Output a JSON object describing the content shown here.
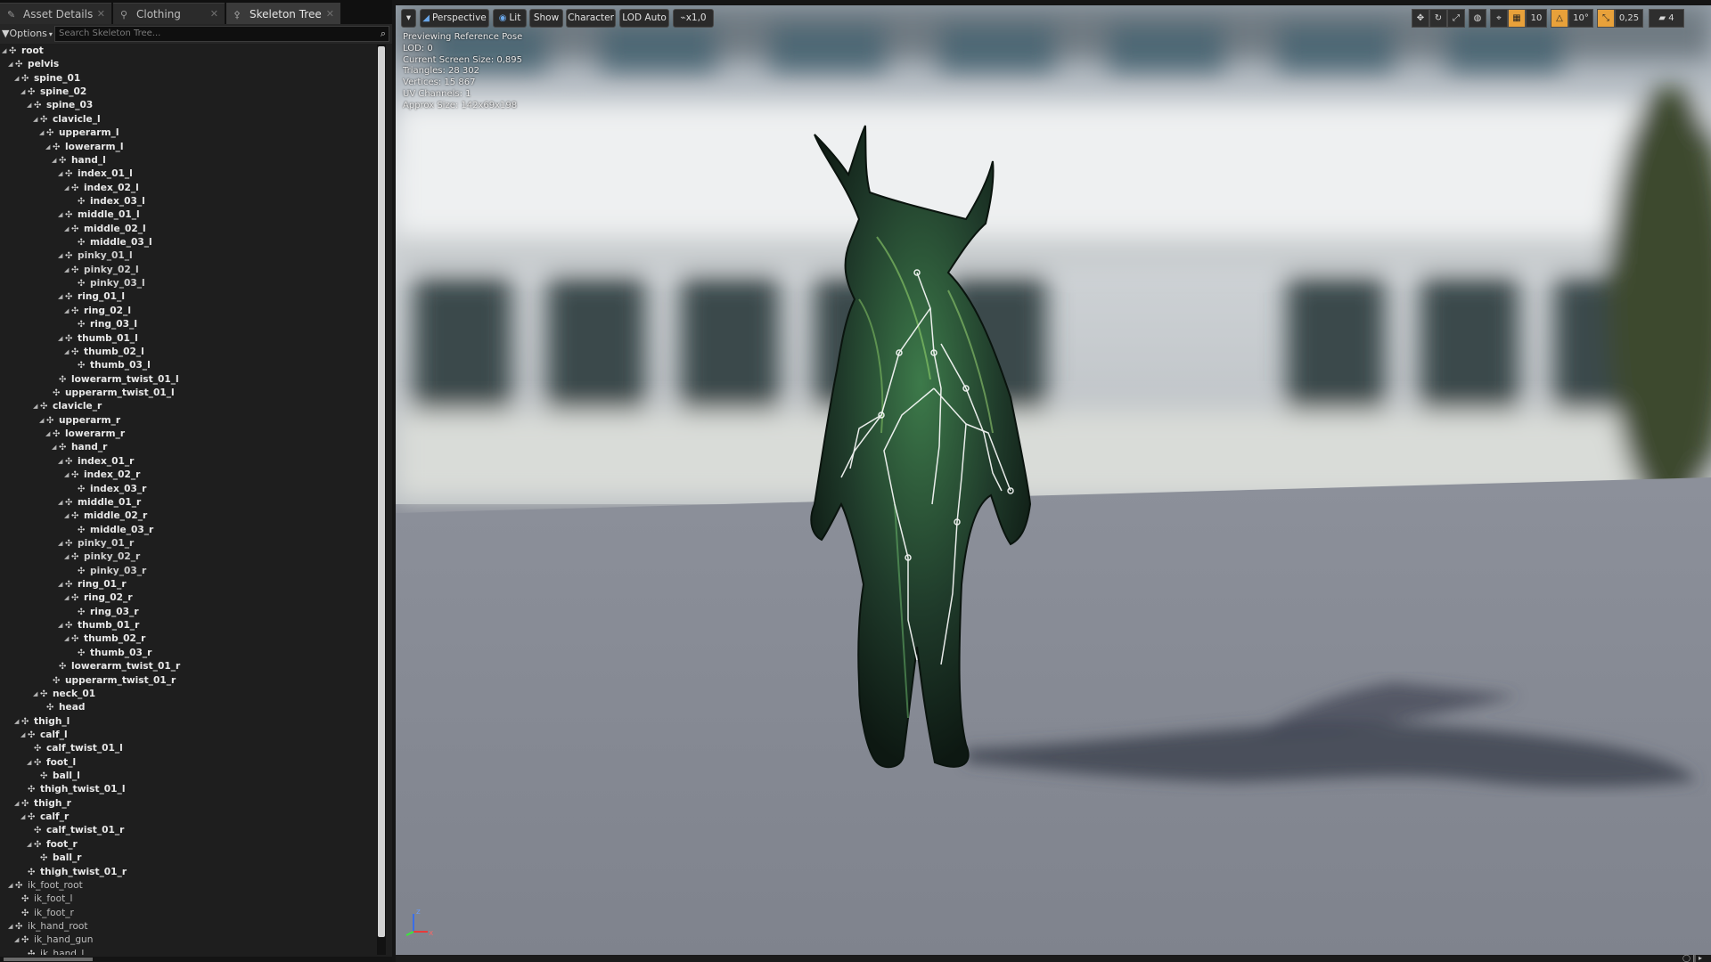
{
  "tabs": [
    {
      "label": "Asset Details",
      "icon": "details-icon"
    },
    {
      "label": "Clothing",
      "icon": "clothing-icon"
    },
    {
      "label": "Skeleton Tree",
      "icon": "skeleton-icon"
    }
  ],
  "options": {
    "label": "Options"
  },
  "search": {
    "placeholder": "Search Skeleton Tree..."
  },
  "tree": [
    {
      "label": "root",
      "depth": 0,
      "exp": true
    },
    {
      "label": "pelvis",
      "depth": 1,
      "exp": true
    },
    {
      "label": "spine_01",
      "depth": 2,
      "exp": true
    },
    {
      "label": "spine_02",
      "depth": 3,
      "exp": true
    },
    {
      "label": "spine_03",
      "depth": 4,
      "exp": true
    },
    {
      "label": "clavicle_l",
      "depth": 5,
      "exp": true
    },
    {
      "label": "upperarm_l",
      "depth": 6,
      "exp": true
    },
    {
      "label": "lowerarm_l",
      "depth": 7,
      "exp": true
    },
    {
      "label": "hand_l",
      "depth": 8,
      "exp": true
    },
    {
      "label": "index_01_l",
      "depth": 9,
      "exp": true
    },
    {
      "label": "index_02_l",
      "depth": 10,
      "exp": true
    },
    {
      "label": "index_03_l",
      "depth": 11,
      "exp": false
    },
    {
      "label": "middle_01_l",
      "depth": 9,
      "exp": true
    },
    {
      "label": "middle_02_l",
      "depth": 10,
      "exp": true
    },
    {
      "label": "middle_03_l",
      "depth": 11,
      "exp": false
    },
    {
      "label": "pinky_01_l",
      "depth": 9,
      "exp": true,
      "dim": true
    },
    {
      "label": "pinky_02_l",
      "depth": 10,
      "exp": true,
      "dim": true
    },
    {
      "label": "pinky_03_l",
      "depth": 11,
      "exp": false,
      "dim": true
    },
    {
      "label": "ring_01_l",
      "depth": 9,
      "exp": true
    },
    {
      "label": "ring_02_l",
      "depth": 10,
      "exp": true
    },
    {
      "label": "ring_03_l",
      "depth": 11,
      "exp": false
    },
    {
      "label": "thumb_01_l",
      "depth": 9,
      "exp": true
    },
    {
      "label": "thumb_02_l",
      "depth": 10,
      "exp": true
    },
    {
      "label": "thumb_03_l",
      "depth": 11,
      "exp": false
    },
    {
      "label": "lowerarm_twist_01_l",
      "depth": 8,
      "exp": false
    },
    {
      "label": "upperarm_twist_01_l",
      "depth": 7,
      "exp": false
    },
    {
      "label": "clavicle_r",
      "depth": 5,
      "exp": true
    },
    {
      "label": "upperarm_r",
      "depth": 6,
      "exp": true
    },
    {
      "label": "lowerarm_r",
      "depth": 7,
      "exp": true
    },
    {
      "label": "hand_r",
      "depth": 8,
      "exp": true
    },
    {
      "label": "index_01_r",
      "depth": 9,
      "exp": true
    },
    {
      "label": "index_02_r",
      "depth": 10,
      "exp": true
    },
    {
      "label": "index_03_r",
      "depth": 11,
      "exp": false
    },
    {
      "label": "middle_01_r",
      "depth": 9,
      "exp": true
    },
    {
      "label": "middle_02_r",
      "depth": 10,
      "exp": true
    },
    {
      "label": "middle_03_r",
      "depth": 11,
      "exp": false
    },
    {
      "label": "pinky_01_r",
      "depth": 9,
      "exp": true,
      "dim": true
    },
    {
      "label": "pinky_02_r",
      "depth": 10,
      "exp": true,
      "dim": true
    },
    {
      "label": "pinky_03_r",
      "depth": 11,
      "exp": false,
      "dim": true
    },
    {
      "label": "ring_01_r",
      "depth": 9,
      "exp": true
    },
    {
      "label": "ring_02_r",
      "depth": 10,
      "exp": true
    },
    {
      "label": "ring_03_r",
      "depth": 11,
      "exp": false
    },
    {
      "label": "thumb_01_r",
      "depth": 9,
      "exp": true
    },
    {
      "label": "thumb_02_r",
      "depth": 10,
      "exp": true
    },
    {
      "label": "thumb_03_r",
      "depth": 11,
      "exp": false
    },
    {
      "label": "lowerarm_twist_01_r",
      "depth": 8,
      "exp": false
    },
    {
      "label": "upperarm_twist_01_r",
      "depth": 7,
      "exp": false
    },
    {
      "label": "neck_01",
      "depth": 5,
      "exp": true
    },
    {
      "label": "head",
      "depth": 6,
      "exp": false
    },
    {
      "label": "thigh_l",
      "depth": 2,
      "exp": true
    },
    {
      "label": "calf_l",
      "depth": 3,
      "exp": true
    },
    {
      "label": "calf_twist_01_l",
      "depth": 4,
      "exp": false
    },
    {
      "label": "foot_l",
      "depth": 4,
      "exp": true
    },
    {
      "label": "ball_l",
      "depth": 5,
      "exp": false
    },
    {
      "label": "thigh_twist_01_l",
      "depth": 3,
      "exp": false
    },
    {
      "label": "thigh_r",
      "depth": 2,
      "exp": true
    },
    {
      "label": "calf_r",
      "depth": 3,
      "exp": true
    },
    {
      "label": "calf_twist_01_r",
      "depth": 4,
      "exp": false
    },
    {
      "label": "foot_r",
      "depth": 4,
      "exp": true
    },
    {
      "label": "ball_r",
      "depth": 5,
      "exp": false
    },
    {
      "label": "thigh_twist_01_r",
      "depth": 3,
      "exp": false
    },
    {
      "label": "ik_foot_root",
      "depth": 1,
      "exp": true,
      "ik": true
    },
    {
      "label": "ik_foot_l",
      "depth": 2,
      "exp": false,
      "ik": true
    },
    {
      "label": "ik_foot_r",
      "depth": 2,
      "exp": false,
      "ik": true
    },
    {
      "label": "ik_hand_root",
      "depth": 1,
      "exp": true,
      "ik": true
    },
    {
      "label": "ik_hand_gun",
      "depth": 2,
      "exp": true,
      "ik": true
    },
    {
      "label": "ik_hand_l",
      "depth": 3,
      "exp": false,
      "ik": true
    }
  ],
  "viewport_toolbar": {
    "menu_icon": "dropdown-arrow-icon",
    "perspective": "Perspective",
    "lit": "Lit",
    "show": "Show",
    "character": "Character",
    "lod": "LOD Auto",
    "speed": "x1,0"
  },
  "viewport_tools": {
    "grid_snap": "10",
    "rotation_snap": "10°",
    "scale_snap": "0,25",
    "camera_speed": "4"
  },
  "viewport_info": [
    "Previewing Reference Pose",
    "LOD: 0",
    "Current Screen Size: 0,895",
    "Triangles: 28 302",
    "Vertices: 15 867",
    "UV Channels: 1",
    "Approx Size: 142x69x198"
  ],
  "axis_labels": {
    "z": "z",
    "x": "x"
  },
  "colors": {
    "accent_blue": "#4a90e2",
    "snap_orange": "#e8a13a",
    "panel_bg": "#1e1e1e",
    "floor": "#8b8f99"
  }
}
